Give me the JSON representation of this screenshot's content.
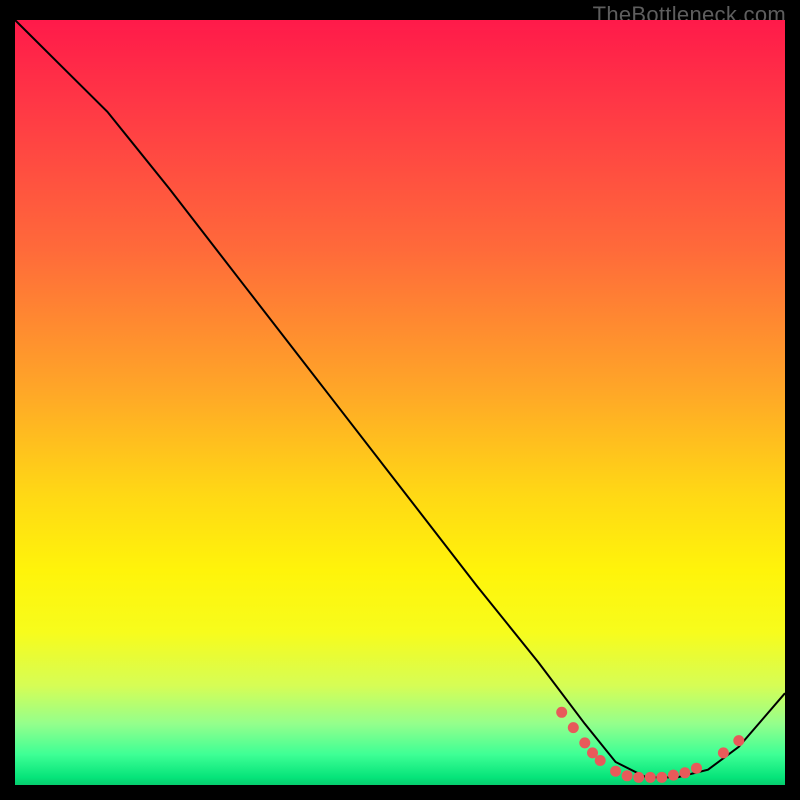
{
  "watermark": "TheBottleneck.com",
  "colors": {
    "curve": "#000000",
    "dots": "#e85a5a"
  },
  "chart_data": {
    "type": "line",
    "title": "",
    "xlabel": "",
    "ylabel": "",
    "xlim": [
      0,
      100
    ],
    "ylim": [
      0,
      100
    ],
    "series": [
      {
        "name": "bottleneck-curve",
        "x": [
          0,
          6,
          12,
          20,
          30,
          40,
          50,
          60,
          68,
          74,
          78,
          82,
          86,
          90,
          94,
          100
        ],
        "y": [
          100,
          94,
          88,
          78,
          65,
          52,
          39,
          26,
          16,
          8,
          3,
          1,
          1,
          2,
          5,
          12
        ]
      }
    ],
    "markers": {
      "name": "highlight-dots",
      "points": [
        {
          "x": 71,
          "y": 9.5
        },
        {
          "x": 72.5,
          "y": 7.5
        },
        {
          "x": 74,
          "y": 5.5
        },
        {
          "x": 75,
          "y": 4.2
        },
        {
          "x": 76,
          "y": 3.2
        },
        {
          "x": 78,
          "y": 1.8
        },
        {
          "x": 79.5,
          "y": 1.2
        },
        {
          "x": 81,
          "y": 1.0
        },
        {
          "x": 82.5,
          "y": 1.0
        },
        {
          "x": 84,
          "y": 1.0
        },
        {
          "x": 85.5,
          "y": 1.3
        },
        {
          "x": 87,
          "y": 1.6
        },
        {
          "x": 88.5,
          "y": 2.2
        },
        {
          "x": 92,
          "y": 4.2
        },
        {
          "x": 94,
          "y": 5.8
        }
      ]
    }
  }
}
